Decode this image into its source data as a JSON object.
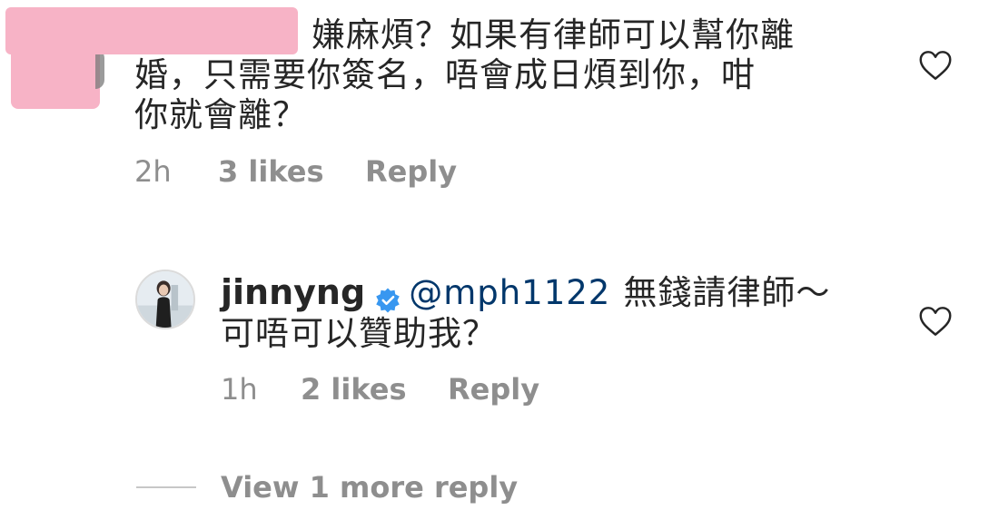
{
  "comment": {
    "lines": [
      "嫌麻煩？如果有律師可以幫你離",
      "婚，只需要你簽名，唔會成日煩到你，咁",
      "你就會離？"
    ],
    "time": "2h",
    "likes": "3 likes",
    "reply_label": "Reply"
  },
  "reply": {
    "username": "jinnyng",
    "mention": "@mph1122",
    "text_line1": "無錢請律師～",
    "text_line2": "可唔可以贊助我？",
    "time": "1h",
    "likes": "2 likes",
    "reply_label": "Reply"
  },
  "view_more_label": "View 1 more reply",
  "icons": {
    "like": "heart-outline-icon",
    "verified": "verified-badge-icon"
  },
  "colors": {
    "text": "#262626",
    "secondary": "#8e8e8e",
    "mention": "#00376b",
    "verified": "#3897f0",
    "redaction": "#f7b3c6"
  }
}
